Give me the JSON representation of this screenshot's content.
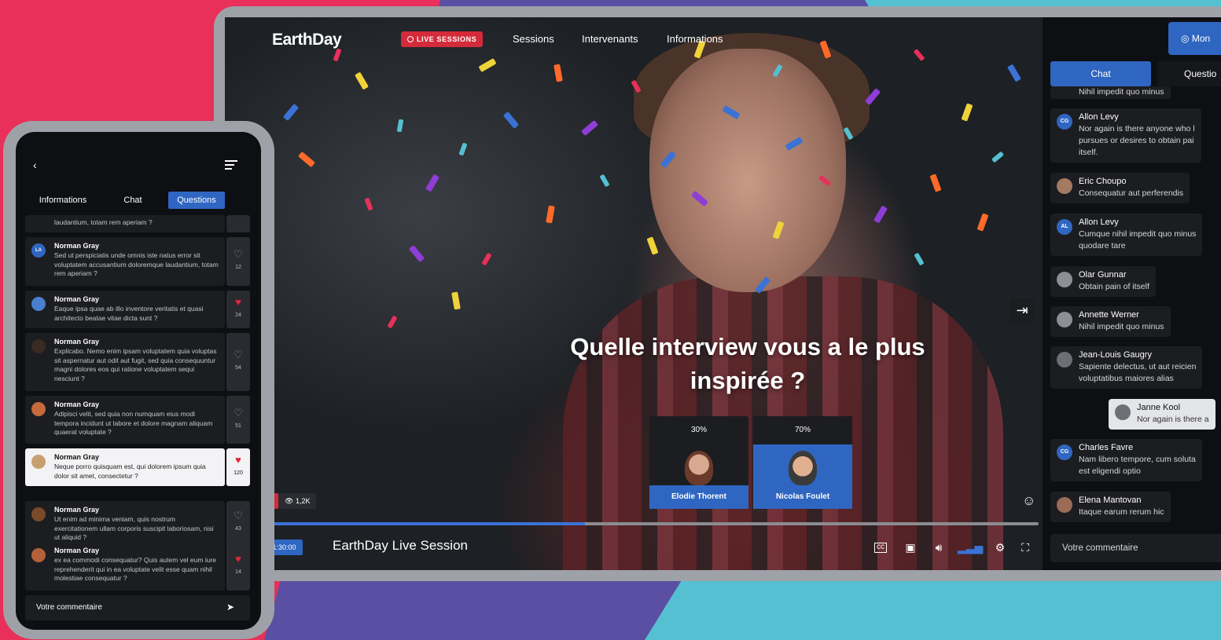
{
  "video": {
    "brand": "EarthDay",
    "live_sessions_label": "LIVE SESSIONS",
    "nav": [
      "Sessions",
      "Intervenants",
      "Informations"
    ],
    "question": "Quelle interview vous a le plus inspirée ?",
    "poll": [
      {
        "percent": "30%",
        "name": "Elodie Thorent",
        "value": 30,
        "selected": false
      },
      {
        "percent": "70%",
        "name": "Nicolas Foulet",
        "value": 70,
        "selected": true
      }
    ],
    "live_badge": "VE",
    "views": "1,2K",
    "progress_fraction": 0.42,
    "time": "2 / 1:30:00",
    "title": "EarthDay Live Session",
    "collapse_icon": "collapse-right-icon",
    "emoji_icon": "emoji-icon"
  },
  "chat": {
    "top_button": "Mon",
    "tabs": [
      {
        "label": "Chat",
        "active": true
      },
      {
        "label": "Questio",
        "active": false
      }
    ],
    "messages": [
      {
        "name": "",
        "text": "Nihil impedit quo minus",
        "initials": "",
        "color": "#1c1d21"
      },
      {
        "name": "Allon Levy",
        "text": "Nor again is there anyone who l",
        "text2": "pursues or desires to obtain pai",
        "text3": "itself.",
        "initials": "CG",
        "color": "#2f66c1"
      },
      {
        "name": "Eric Choupo",
        "text": "Consequatur aut perferendis",
        "initials": "",
        "color": "#a57a62"
      },
      {
        "name": "Allon Levy",
        "text": "Cumque nihil impedit quo minus",
        "text2": "quodare tare",
        "initials": "AL",
        "color": "#2f66c1"
      },
      {
        "name": "Olar Gunnar",
        "text": "Obtain pain of itself",
        "initials": "",
        "color": "#8d8f96"
      },
      {
        "name": "Annette Werner",
        "text": "Nihil impedit quo minus",
        "initials": "",
        "color": "#8d8f96"
      },
      {
        "name": "Jean-Louis Gaugry",
        "text": "Sapiente delectus, ut aut reicien",
        "text2": "voluptatibus maiores alias",
        "initials": "",
        "color": "#6d6f74"
      },
      {
        "name": "Janne Kool",
        "text": "Nor again is there a",
        "initials": "",
        "color": "#6d6f74",
        "highlight": true
      },
      {
        "name": "Charles Favre",
        "text": "Nam libero tempore, cum soluta",
        "text2": "est eligendi optio",
        "initials": "CG",
        "color": "#2f66c1"
      },
      {
        "name": "Elena Mantovan",
        "text": "Itaque earum rerum hic",
        "initials": "",
        "color": "#9a6b55"
      }
    ],
    "comment_placeholder": "Votre commentaire"
  },
  "phone": {
    "tabs": [
      {
        "label": "Informations",
        "active": false
      },
      {
        "label": "Chat",
        "active": false
      },
      {
        "label": "Questions",
        "active": true
      }
    ],
    "partial_text": "laudantium, totam rem aperiam ?",
    "questions": [
      {
        "name": "Norman Gray",
        "text": "Sed ut perspiciatis unde omnis iste natus error sit voluptatem accusantium doloremque laudantium, totam rem aperiam ?",
        "likes": "12",
        "liked": false,
        "initials": "LA",
        "color": "#2f66c1"
      },
      {
        "name": "Norman Gray",
        "text": "Eaque ipsa quae ab illo inventore veritatis et quasi architecto beatae vitae dicta sunt ?",
        "likes": "24",
        "liked": true,
        "initials": "",
        "color": "#4a7fd0"
      },
      {
        "name": "Norman Gray",
        "text": "Explicabo. Nemo enim ipsam voluptatem quia voluptas sit aspernatur aut odit aut fugit, sed quia consequuntur magni dolores eos qui ratione voluptatem sequi nesciunt ?",
        "likes": "54",
        "liked": false,
        "initials": "",
        "color": "#3a2a24"
      },
      {
        "name": "Norman Gray",
        "text": "Adipisci velit, sed quia non numquam eius modi tempora incidunt ut labore et dolore magnam aliquam quaerat voluptate ?",
        "likes": "51",
        "liked": false,
        "initials": "",
        "color": "#c56a3a"
      },
      {
        "name": "Norman Gray",
        "text": "Neque porro quisquam est, qui dolorem ipsum quia dolor sit amet, consectetur ?",
        "likes": "120",
        "liked": true,
        "initials": "",
        "color": "#c8a070",
        "highlight": true
      },
      {
        "name": "Norman Gray",
        "text": "Ut enim ad minima veniam, quis nostrum exercitationem ullam corporis suscipit laboriosam, nisi ut aliquid ?",
        "likes": "43",
        "liked": false,
        "initials": "",
        "color": "#7a4a2a"
      },
      {
        "name": "Norman Gray",
        "text": "ex ea commodi consequatur? Quis autem vel eum iure reprehenderit qui in ea voluptate velit esse quam nihil molestiae consequatur ?",
        "likes": "14",
        "liked": true,
        "initials": "",
        "color": "#b5603a"
      }
    ],
    "comment_placeholder": "Votre commentaire"
  },
  "colors": {
    "accent": "#2f66c1",
    "live_red": "#d42b3a",
    "like_red": "#e0283a"
  }
}
